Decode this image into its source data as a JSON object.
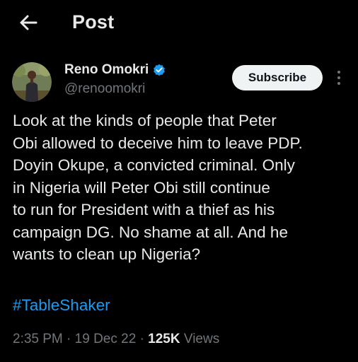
{
  "header": {
    "back_icon": "arrow-left-icon",
    "title": "Post"
  },
  "author": {
    "display_name": "Reno Omokri",
    "handle": "@renoomokri",
    "verified_icon": "verified-badge-icon",
    "verified_color": "#1d9bf0"
  },
  "actions": {
    "subscribe_label": "Subscribe",
    "more_icon": "more-vertical-icon"
  },
  "post": {
    "text_lines": [
      "Look at the kinds of people that Peter",
      "Obi allowed to deceive him to leave PDP.",
      "Doyin Okupe, a convicted criminal. Only",
      "in Nigeria will Peter Obi still continue",
      "to run for President with a thief as his",
      "campaign DG. No shame at all. And he",
      "wants to clean up Nigeria?"
    ],
    "hashtag": "#TableShaker",
    "time": "2:35 PM",
    "date": "19 Dec 22",
    "views_count": "125K",
    "views_label": "Views",
    "separator": "·"
  },
  "colors": {
    "background": "#000000",
    "text": "#e7e9ea",
    "secondary_text": "#71767b",
    "link": "#1d9bf0",
    "button_bg": "#eff3f4"
  }
}
